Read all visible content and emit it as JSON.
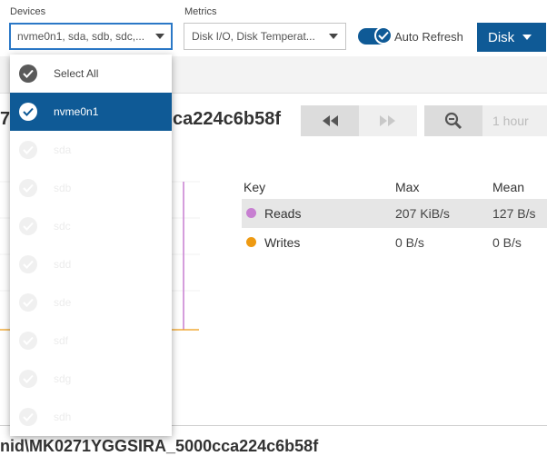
{
  "toolbar": {
    "devices_label": "Devices",
    "devices_value": "nvme0n1, sda, sdb, sdc,...",
    "metrics_label": "Metrics",
    "metrics_value": "Disk I/O, Disk Temperat...",
    "auto_refresh_label": "Auto Refresh",
    "auto_refresh_on": true,
    "disk_button_label": "Disk"
  },
  "dropdown": {
    "select_all_label": "Select All",
    "items": [
      {
        "label": "nvme0n1",
        "checked": true,
        "selected": true
      },
      {
        "label": "sda",
        "checked": true
      },
      {
        "label": "sdb",
        "checked": true
      },
      {
        "label": "sdc",
        "checked": true
      },
      {
        "label": "sdd",
        "checked": true
      },
      {
        "label": "sde",
        "checked": true
      },
      {
        "label": "sdf",
        "checked": true
      },
      {
        "label": "sdg",
        "checked": true
      },
      {
        "label": "sdh",
        "checked": true
      }
    ]
  },
  "panel": {
    "title_prefix": "7",
    "title_suffix": "ca224c6b58f",
    "time_range": "1 hour"
  },
  "legend_table": {
    "headers": [
      "Key",
      "Max",
      "Mean"
    ],
    "rows": [
      {
        "key": "Reads",
        "color": "#c77fd1",
        "max": "207 KiB/s",
        "mean": "127 B/s"
      },
      {
        "key": "Writes",
        "color": "#ee9a12",
        "max": "0 B/s",
        "mean": "0 B/s"
      }
    ]
  },
  "next_panel": {
    "title": "nid\\MK0271YGGSIRA_5000cca224c6b58f"
  },
  "colors": {
    "accent": "#0f5a96",
    "reads": "#c77fd1",
    "writes": "#ee9a12"
  }
}
